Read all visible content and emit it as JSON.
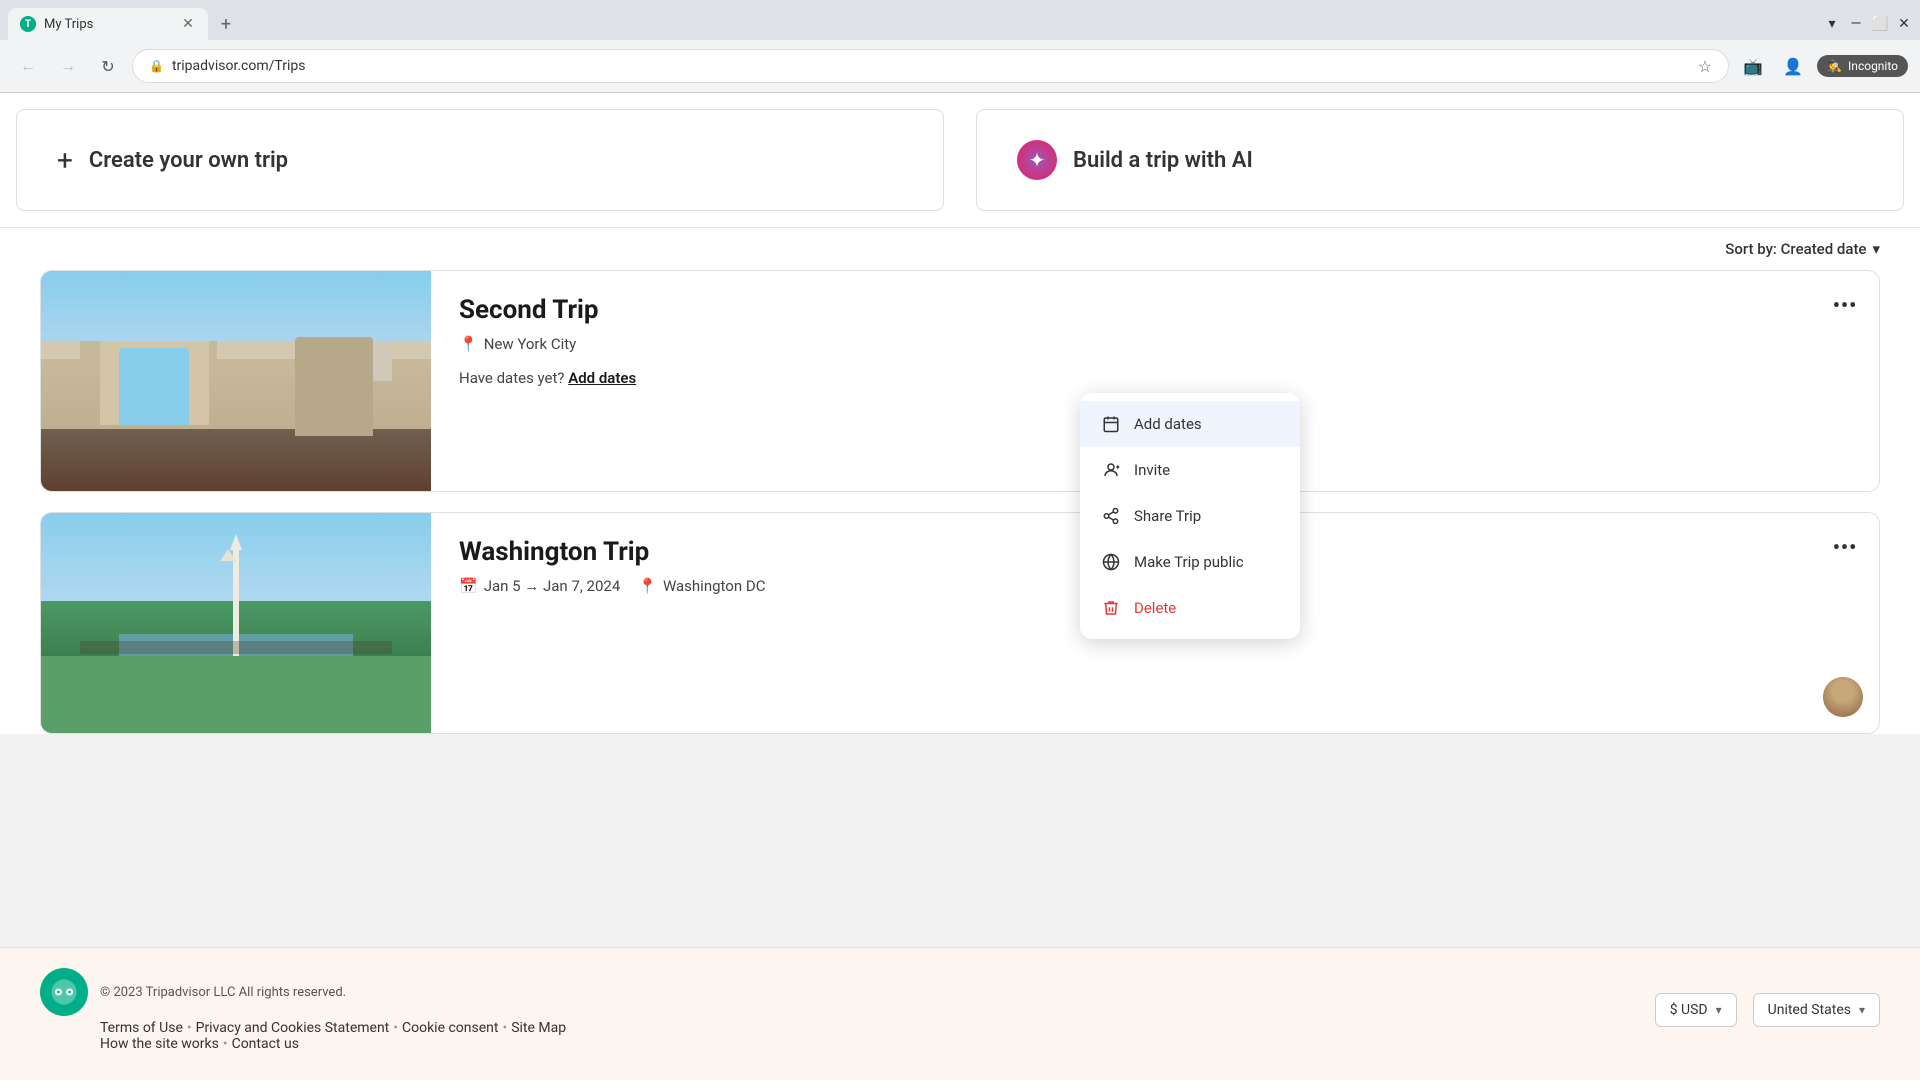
{
  "browser": {
    "tab_title": "My Trips",
    "favicon_letter": "T",
    "url": "tripadvisor.com/Trips",
    "incognito_label": "Incognito"
  },
  "page": {
    "create_trip_label": "Create your own trip",
    "build_ai_label": "Build a trip with AI",
    "sort_label": "Sort by: Created date"
  },
  "trips": [
    {
      "id": "second-trip",
      "name": "Second Trip",
      "location": "New York City",
      "has_dates": false,
      "add_dates_prompt": "Have dates yet?",
      "add_dates_link": "Add dates",
      "image_type": "nyc"
    },
    {
      "id": "washington-trip",
      "name": "Washington Trip",
      "location": "Washington DC",
      "has_dates": true,
      "date_range": "Jan 5 → Jan 7, 2024",
      "image_type": "dc"
    }
  ],
  "context_menu": {
    "items": [
      {
        "id": "add-dates",
        "label": "Add dates",
        "icon": "📅",
        "active": true
      },
      {
        "id": "invite",
        "label": "Invite",
        "icon": "👤"
      },
      {
        "id": "share-trip",
        "label": "Share Trip",
        "icon": "🔗"
      },
      {
        "id": "make-public",
        "label": "Make Trip public",
        "icon": "🌐"
      },
      {
        "id": "delete",
        "label": "Delete",
        "icon": "🗑",
        "is_delete": true
      }
    ]
  },
  "footer": {
    "copyright": "© 2023 Tripadvisor LLC All rights reserved.",
    "links": [
      {
        "label": "Terms of Use"
      },
      {
        "label": "Privacy and Cookies Statement"
      },
      {
        "label": "Cookie consent"
      },
      {
        "label": "Site Map"
      }
    ],
    "bottom_links": [
      {
        "label": "How the site works"
      },
      {
        "label": "Contact us"
      }
    ],
    "currency": "$ USD",
    "country": "United States"
  }
}
